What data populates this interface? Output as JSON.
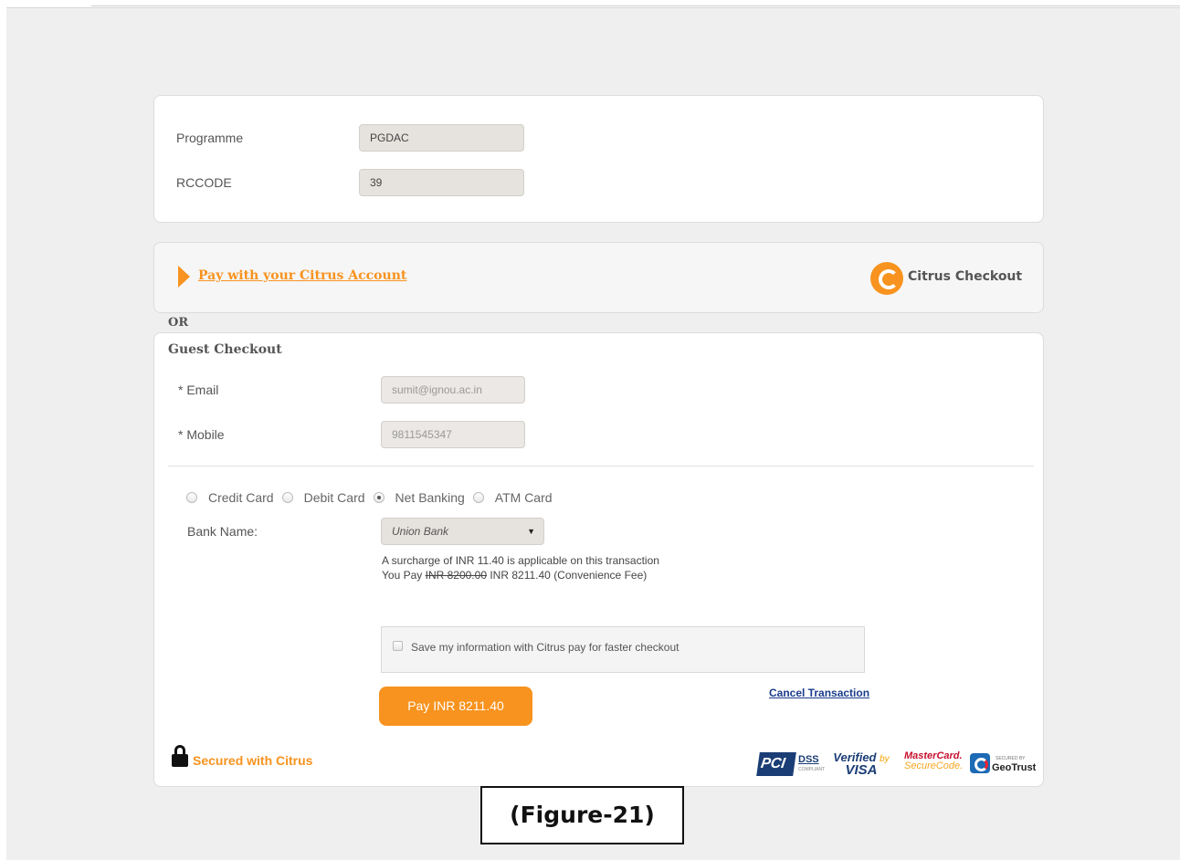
{
  "programme": {
    "label": "Programme",
    "value": "PGDAC"
  },
  "rccode": {
    "label": "RCCODE",
    "value": "39"
  },
  "citrus_account": {
    "link_label": "Pay with your Citrus Account",
    "brand_label": "Citrus Checkout"
  },
  "or_label": "OR",
  "guest": {
    "title": "Guest Checkout",
    "email_label": "* Email",
    "email_value": "sumit@ignou.ac.in",
    "mobile_label": "* Mobile",
    "mobile_value": "9811545347"
  },
  "payment_methods": [
    {
      "label": "Credit Card",
      "selected": false
    },
    {
      "label": "Debit Card",
      "selected": false
    },
    {
      "label": "Net Banking",
      "selected": true
    },
    {
      "label": "ATM Card",
      "selected": false
    }
  ],
  "bank": {
    "label": "Bank Name:",
    "selected": "Union Bank"
  },
  "surcharge": {
    "line1": "A surcharge of INR 11.40 is applicable on this transaction",
    "you_pay_prefix": "You Pay",
    "original_amount": "INR 8200.00",
    "new_amount": "INR 8211.40",
    "fee_note": "(Convenience Fee)"
  },
  "save_info_label": "Save my information with Citrus pay for faster checkout",
  "pay_button_label": "Pay INR 8211.40",
  "cancel_label": "Cancel Transaction",
  "secured_label": "Secured with Citrus",
  "badges": {
    "pci_a": "PCI",
    "pci_b": "DSS",
    "pci_c": "COMPLIANT",
    "vbv_a": "Verified",
    "vbv_by": "by",
    "vbv_b": "VISA",
    "mc_a": "MasterCard.",
    "mc_b": "SecureCode.",
    "geo_a": "SECURED BY",
    "geo_b": "GeoTrust"
  },
  "figure_caption": "(Figure-21)",
  "colors": {
    "accent": "#f7931e",
    "link": "#1b3c8c"
  }
}
